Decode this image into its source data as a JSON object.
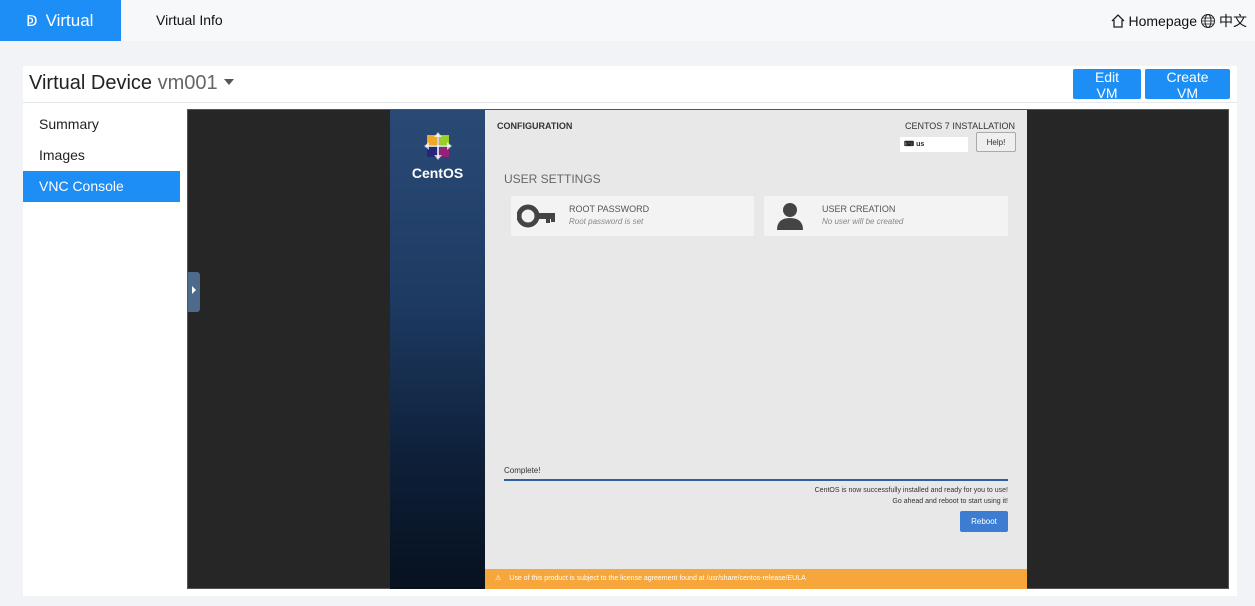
{
  "topnav": {
    "brand": "Virtual",
    "links": [
      "Virtual Info"
    ],
    "homepage": "Homepage",
    "language": "中文"
  },
  "header": {
    "title": "Virtual Device",
    "vm_name": "vm001",
    "buttons": {
      "edit": "Edit VM",
      "create": "Create VM"
    }
  },
  "sidebar": {
    "items": [
      {
        "label": "Summary",
        "active": false
      },
      {
        "label": "Images",
        "active": false
      },
      {
        "label": "VNC Console",
        "active": true
      }
    ]
  },
  "vnc": {
    "brand": "CentOS",
    "config_title": "CONFIGURATION",
    "install_title": "CENTOS 7 INSTALLATION",
    "keyboard": "us",
    "help_label": "Help!",
    "section": "USER SETTINGS",
    "spokes": [
      {
        "title": "ROOT PASSWORD",
        "status": "Root password is set"
      },
      {
        "title": "USER CREATION",
        "status": "No user will be created"
      }
    ],
    "progress_label": "Complete!",
    "progress": 1.0,
    "finish_line1": "CentOS is now successfully installed and ready for you to use!",
    "finish_line2": "Go ahead and reboot to start using it!",
    "reboot_label": "Reboot",
    "eula": "Use of this product is subject to the license agreement found at /usr/share/centos-release/EULA"
  },
  "colors": {
    "accent": "#1c8ef5",
    "eula_bar": "#f6a63a",
    "progress": "#2d5fa2"
  }
}
